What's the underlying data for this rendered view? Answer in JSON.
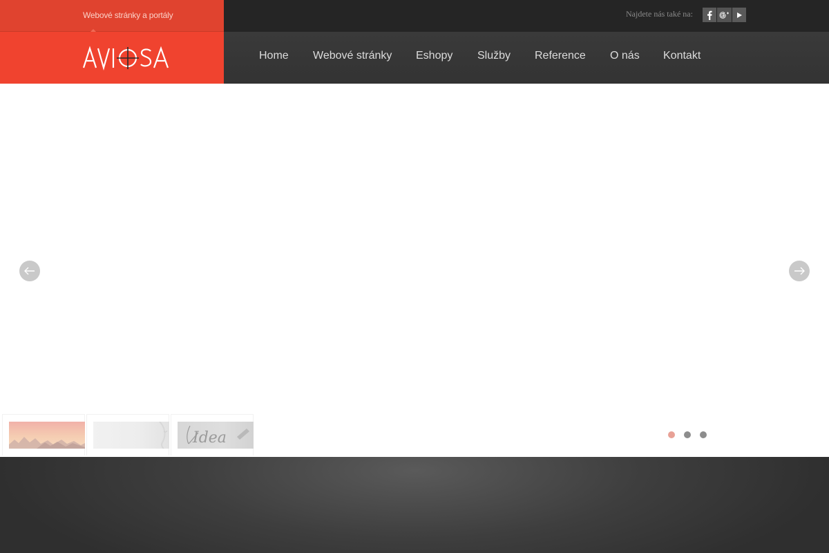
{
  "topbar": {
    "tagline": "Webové stránky a portály",
    "social_label": "Najdete nás také na:",
    "social_icons": [
      "facebook-icon",
      "google-plus-icon",
      "youtube-icon"
    ]
  },
  "brand": {
    "logo_text": "AVIOSA",
    "accent_color": "#f0432f"
  },
  "nav": {
    "items": [
      {
        "label": "Home"
      },
      {
        "label": "Webové stránky"
      },
      {
        "label": "Eshopy"
      },
      {
        "label": "Služby"
      },
      {
        "label": "Reference"
      },
      {
        "label": "O nás"
      },
      {
        "label": "Kontakt"
      }
    ]
  },
  "slider": {
    "prev_icon": "arrow-left-icon",
    "next_icon": "arrow-right-icon",
    "thumbnails": [
      {
        "name": "thumbnail-mountains"
      },
      {
        "name": "thumbnail-face"
      },
      {
        "name": "thumbnail-idea"
      }
    ],
    "thumb3_text": "Idea",
    "dot_count": 3,
    "active_dot": 1
  }
}
